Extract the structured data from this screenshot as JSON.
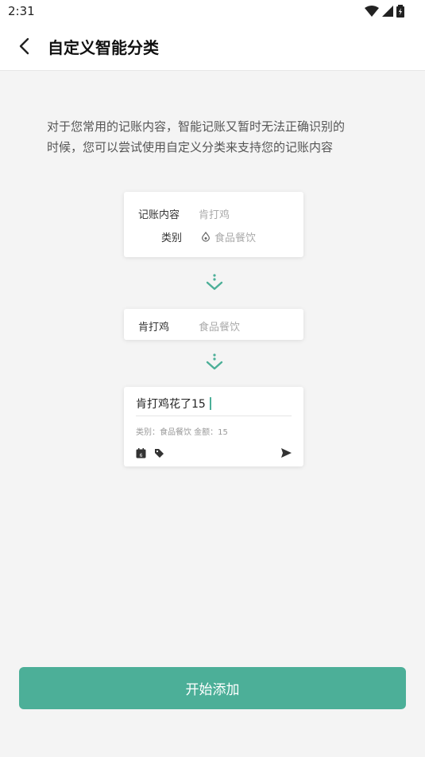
{
  "status_bar": {
    "time": "2:31"
  },
  "header": {
    "title": "自定义智能分类"
  },
  "intro": {
    "line1": "对于您常用的记账内容，智能记账又暂时无法正确识别的",
    "line2": "时候，您可以尝试使用自定义分类来支持您的记账内容"
  },
  "card1": {
    "content_label": "记账内容",
    "content_value": "肯打鸡",
    "category_label": "类别",
    "category_value": "食品餐饮"
  },
  "card2": {
    "keyword": "肯打鸡",
    "category": "食品餐饮"
  },
  "card3": {
    "input_text": "肯打鸡花了15",
    "meta": "类别：食品餐饮 金额：15",
    "calendar_day": "6"
  },
  "button": {
    "label": "开始添加"
  },
  "colors": {
    "accent": "#4caf98",
    "background": "#f4f4f4"
  }
}
